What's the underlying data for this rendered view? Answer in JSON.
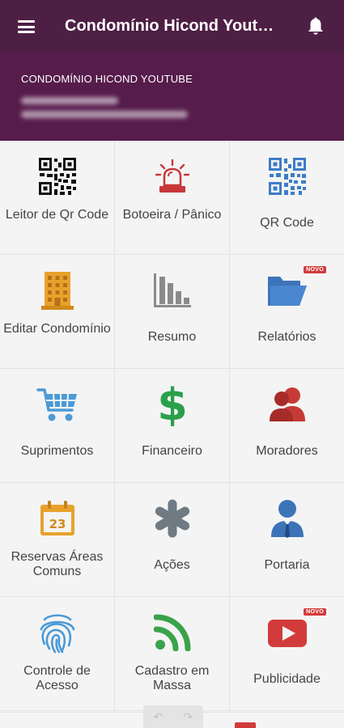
{
  "appbar": {
    "title": "Condomínio Hicond Youtube",
    "menu_icon": "hamburger-menu-icon",
    "notification_icon": "bell-icon"
  },
  "header": {
    "condo_name": "CONDOMÍNIO HICOND YOUTUBE"
  },
  "colors": {
    "appbar": "#4e1f44",
    "header": "#561c4b",
    "badge": "#d23b3b"
  },
  "menu": [
    {
      "label": "Leitor de Qr Code",
      "icon": "qr-code-black-icon"
    },
    {
      "label": "Botoeira / Pânico",
      "icon": "siren-alarm-icon"
    },
    {
      "label": "QR Code",
      "icon": "qr-code-blue-icon"
    },
    {
      "label": "Editar Condomínio",
      "icon": "building-icon"
    },
    {
      "label": "Resumo",
      "icon": "bar-chart-icon"
    },
    {
      "label": "Relatórios",
      "icon": "folder-open-icon",
      "badge": "NOVO"
    },
    {
      "label": "Suprimentos",
      "icon": "shopping-cart-icon"
    },
    {
      "label": "Financeiro",
      "icon": "dollar-sign-icon"
    },
    {
      "label": "Moradores",
      "icon": "residents-icon"
    },
    {
      "label": "Reservas Áreas Comuns",
      "icon": "calendar-icon",
      "day": "23"
    },
    {
      "label": "Ações",
      "icon": "asterisk-icon"
    },
    {
      "label": "Portaria",
      "icon": "doorman-icon"
    },
    {
      "label": "Controle de Acesso",
      "icon": "fingerprint-icon"
    },
    {
      "label": "Cadastro em Massa",
      "icon": "rss-feed-icon"
    },
    {
      "label": "Publicidade",
      "icon": "video-play-icon",
      "badge": "NOVO"
    }
  ]
}
